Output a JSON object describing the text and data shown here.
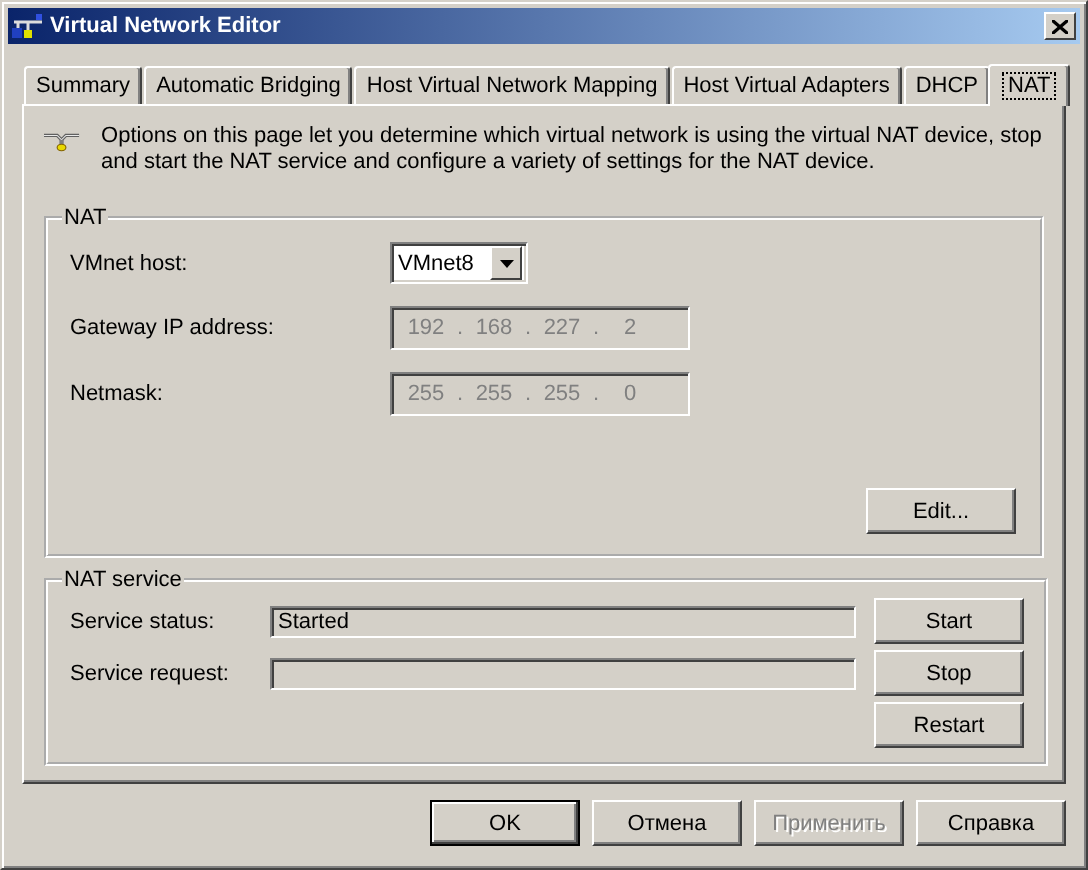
{
  "window": {
    "title": "Virtual Network Editor"
  },
  "tabs": [
    {
      "label": "Summary",
      "selected": false
    },
    {
      "label": "Automatic Bridging",
      "selected": false
    },
    {
      "label": "Host Virtual Network Mapping",
      "selected": false
    },
    {
      "label": "Host Virtual Adapters",
      "selected": false
    },
    {
      "label": "DHCP",
      "selected": false
    },
    {
      "label": "NAT",
      "selected": true
    }
  ],
  "description": "Options on this page let you determine which virtual network is using the virtual NAT device, stop and start the NAT service and configure a variety of settings for the NAT device.",
  "nat": {
    "title": "NAT",
    "vmnet_host": {
      "label": "VMnet host:",
      "value": "VMnet8"
    },
    "gateway": {
      "label": "Gateway IP address:",
      "octets": [
        "192",
        "168",
        "227",
        "2"
      ],
      "separator": ".",
      "disabled": true
    },
    "netmask": {
      "label": "Netmask:",
      "octets": [
        "255",
        "255",
        "255",
        "0"
      ],
      "separator": ".",
      "disabled": true
    },
    "edit_button": {
      "label": "Edit..."
    }
  },
  "nat_service": {
    "title": "NAT service",
    "status": {
      "label": "Service status:",
      "value": "Started"
    },
    "request": {
      "label": "Service request:"
    },
    "buttons": [
      {
        "label": "Start"
      },
      {
        "label": "Stop"
      },
      {
        "label": "Restart"
      }
    ]
  },
  "buttons": [
    {
      "label": "OK",
      "default": true,
      "disabled": false
    },
    {
      "label": "Отмена",
      "default": false,
      "disabled": false
    },
    {
      "label": "Применить",
      "default": false,
      "disabled": true
    },
    {
      "label": "Справка",
      "default": false,
      "disabled": false
    }
  ]
}
